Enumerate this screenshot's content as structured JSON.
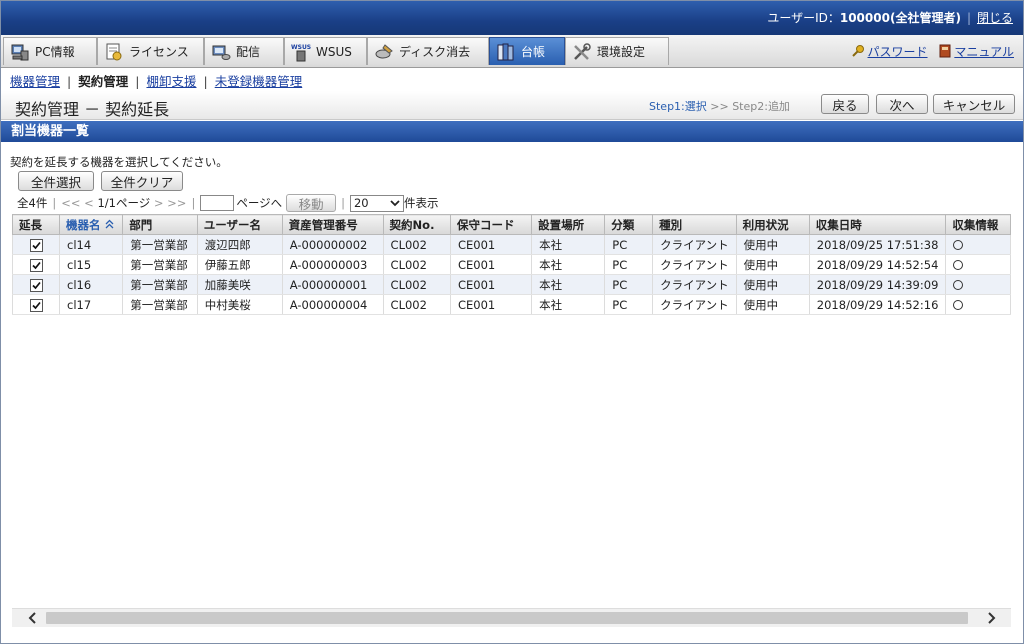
{
  "header": {
    "user_label": "ユーザーID：",
    "user_id": "100000(全社管理者)",
    "separator": "|",
    "close_link": "閉じる"
  },
  "tabs": [
    {
      "label": "PC情報",
      "icon": "pc-icon",
      "active": false
    },
    {
      "label": "ライセンス",
      "icon": "license-icon",
      "active": false
    },
    {
      "label": "配信",
      "icon": "distribution-icon",
      "active": false
    },
    {
      "label": "WSUS",
      "icon": "wsus-icon",
      "active": false
    },
    {
      "label": "ディスク消去",
      "icon": "disk-erase-icon",
      "active": false
    },
    {
      "label": "台帳",
      "icon": "ledger-icon",
      "active": true
    },
    {
      "label": "環境設定",
      "icon": "settings-tools-icon",
      "active": false
    }
  ],
  "toplinks": {
    "password": "パスワード",
    "manual": "マニュアル"
  },
  "subnav": {
    "items": [
      "機器管理",
      "契約管理",
      "棚卸支援",
      "未登録機器管理"
    ],
    "separator": "|",
    "current_index": 1
  },
  "page": {
    "title": "契約管理 － 契約延長",
    "step1": "Step1:選択",
    "step_arrow": ">>",
    "step2": "Step2:追加",
    "back_button": "戻る",
    "next_button": "次へ",
    "cancel_button": "キャンセル"
  },
  "section": {
    "title": "割当機器一覧",
    "instruction": "契約を延長する機器を選択してください。",
    "select_all_button": "全件選択",
    "clear_all_button": "全件クリア"
  },
  "pager": {
    "total": "全4件",
    "first": "<<",
    "prev": "<",
    "page_info": "1/1ページ",
    "next": ">",
    "last": ">>",
    "page_input_value": "",
    "goto_label": "ページへ",
    "move_button": "移動",
    "per_page_value": "20",
    "per_page_suffix": "件表示"
  },
  "table": {
    "columns": [
      "延長",
      "機器名",
      "部門",
      "ユーザー名",
      "資産管理番号",
      "契約No.",
      "保守コード",
      "設置場所",
      "分類",
      "種別",
      "利用状況",
      "収集日時",
      "収集情報"
    ],
    "sorted_column_index": 1,
    "rows": [
      {
        "checked": true,
        "cells": [
          "cl14",
          "第一営業部",
          "渡辺四郎",
          "A-000000002",
          "CL002",
          "CE001",
          "本社",
          "PC",
          "クライアント",
          "使用中",
          "2018/09/25 17:51:38"
        ]
      },
      {
        "checked": true,
        "cells": [
          "cl15",
          "第一営業部",
          "伊藤五郎",
          "A-000000003",
          "CL002",
          "CE001",
          "本社",
          "PC",
          "クライアント",
          "使用中",
          "2018/09/29 14:52:54"
        ]
      },
      {
        "checked": true,
        "cells": [
          "cl16",
          "第一営業部",
          "加藤美咲",
          "A-000000001",
          "CL002",
          "CE001",
          "本社",
          "PC",
          "クライアント",
          "使用中",
          "2018/09/29 14:39:09"
        ]
      },
      {
        "checked": true,
        "cells": [
          "cl17",
          "第一営業部",
          "中村美桜",
          "A-000000004",
          "CL002",
          "CE001",
          "本社",
          "PC",
          "クライアント",
          "使用中",
          "2018/09/29 14:52:16"
        ]
      }
    ]
  },
  "colors": {
    "header_blue": "#1a3f86",
    "active_tab": "#2a5fb0",
    "link": "#1a3fa0",
    "row_alt": "#edf1f8"
  }
}
